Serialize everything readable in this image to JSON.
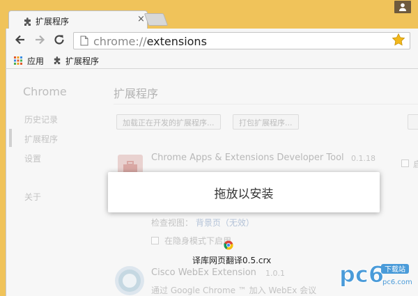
{
  "browser": {
    "tab": {
      "title": "扩展程序",
      "close": "×"
    },
    "omnibox": {
      "scheme": "chrome://",
      "path": "extensions"
    },
    "bookmarks": [
      {
        "label": "应用"
      },
      {
        "label": "扩展程序"
      }
    ]
  },
  "sidebar": {
    "title": "Chrome",
    "items": [
      {
        "label": "历史记录"
      },
      {
        "label": "扩展程序"
      },
      {
        "label": "设置"
      },
      {
        "label": "关于"
      }
    ]
  },
  "main": {
    "title": "扩展程序",
    "buttons": [
      {
        "label": "加载正在开发的扩展程序..."
      },
      {
        "label": "打包扩展程序..."
      }
    ],
    "extensions": [
      {
        "name": "Chrome Apps & Extensions Developer Tool",
        "version": "0.1.18",
        "inspect_label": "检查视图：",
        "inspect_link": "背景页（无效）",
        "incognito_label": "在隐身模式下启用"
      },
      {
        "name": "Cisco WebEx Extension",
        "version": "1.0.1",
        "description": "通过 Google Chrome ™ 加入 WebEx 会议"
      }
    ],
    "enable_label": "启"
  },
  "drop_overlay": {
    "message": "拖放以安装"
  },
  "drag": {
    "filename": "译库网页翻译0.5.crx"
  },
  "watermark": {
    "text": "pc6",
    "sub": "下载站",
    "url": "pc6.com"
  },
  "colors": {
    "frame": "#f0c35a",
    "accent_star": "#f2b81c"
  }
}
